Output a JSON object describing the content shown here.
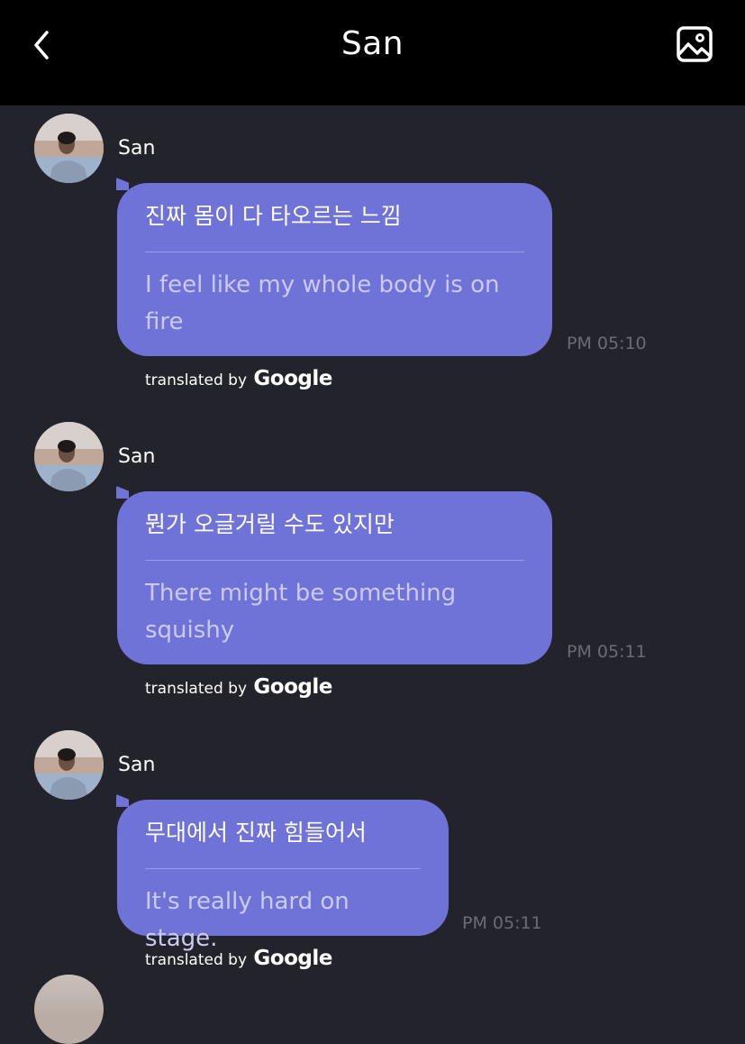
{
  "header": {
    "title": "San",
    "back_icon": "chevron-left-icon",
    "gallery_icon": "image-icon"
  },
  "messages": [
    {
      "sender": "San",
      "original": "진짜 몸이 다 타오르는 느낌",
      "translation": "I feel like my whole body is on fire",
      "time": "PM 05:10",
      "credit_prefix": "translated by",
      "credit_brand": "Google"
    },
    {
      "sender": "San",
      "original": "뭔가 오글거릴 수도 있지만",
      "translation": "There might be something squishy",
      "time": "PM 05:11",
      "credit_prefix": "translated by",
      "credit_brand": "Google"
    },
    {
      "sender": "San",
      "original": "무대에서 진짜 힘들어서",
      "translation": "It's really hard on stage.",
      "time": "PM 05:11",
      "credit_prefix": "translated by",
      "credit_brand": "Google"
    }
  ],
  "colors": {
    "background": "#23232b",
    "header": "#000000",
    "bubble": "#6f72d6",
    "translation_text": "#c9cbf2",
    "timestamp": "#6b6b78"
  }
}
